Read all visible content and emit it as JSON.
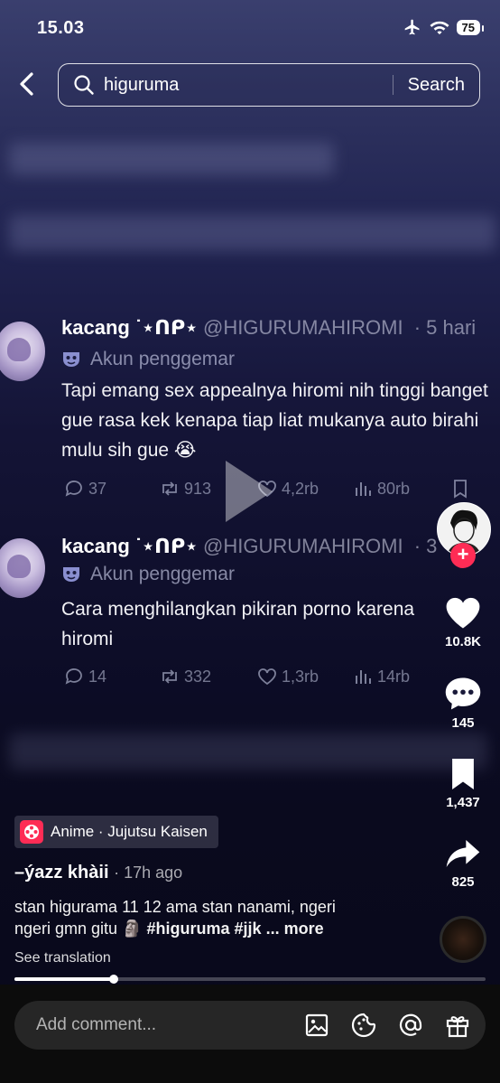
{
  "status": {
    "time": "15.03",
    "battery": "75"
  },
  "search": {
    "query": "higuruma",
    "button": "Search"
  },
  "tweets": [
    {
      "name": "kacang ˙⋆ᑎᑭ⋆",
      "handle": "@HIGURUMAHIROMI",
      "age": "· 5 hari",
      "badge": "Akun penggemar",
      "text": "Tapi emang sex appealnya hiromi nih tinggi banget gue rasa kek kenapa tiap liat mukanya auto birahi mulu sih gue 😭",
      "replies": "37",
      "reposts": "913",
      "likes": "4,2rb",
      "views": "80rb"
    },
    {
      "name": "kacang ˙⋆ᑎᑭ⋆",
      "handle": "@HIGURUMAHIROMI",
      "age": "· 3",
      "badge": "Akun penggemar",
      "text": "Cara menghilangkan pikiran porno karena hiromi",
      "replies": "14",
      "reposts": "332",
      "likes": "1,3rb",
      "views": "14rb"
    }
  ],
  "rail": {
    "likes": "10.8K",
    "comments": "145",
    "saves": "1,437",
    "shares": "825"
  },
  "video": {
    "tag": "Anime · Jujutsu Kaisen",
    "author": "–ýazz khàii",
    "ago": "· 17h ago",
    "caption_line1": "stan higurama 11 12 ama stan nanami, ngeri",
    "caption_line2": "ngeri gmn gitu 🗿",
    "hashtags": "#higuruma #jjk",
    "more": "... more",
    "translate": "See translation",
    "progress": 0.21
  },
  "comment": {
    "placeholder": "Add comment..."
  },
  "colors": {
    "accent": "#fe2c55",
    "bg_top": "#3a3f6e",
    "bg_bottom": "#08081a"
  }
}
